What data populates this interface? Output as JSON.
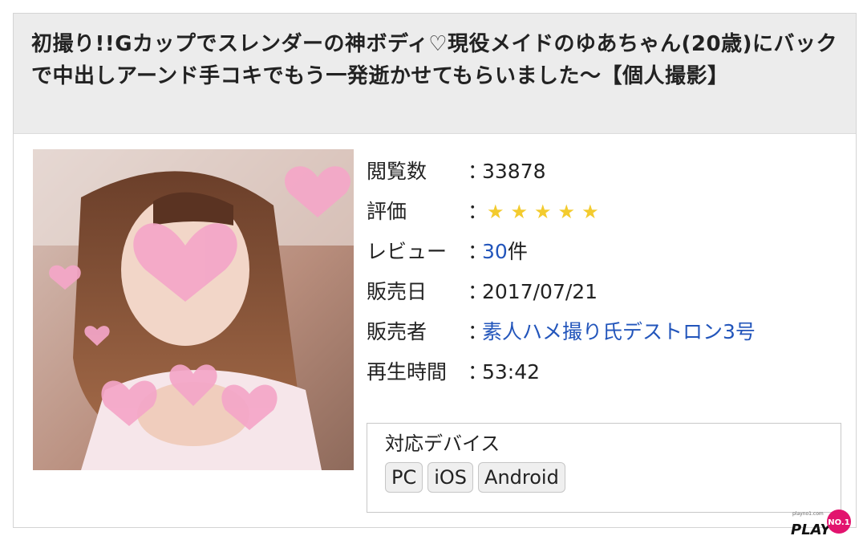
{
  "title": "初撮り!!Gカップでスレンダーの神ボディ♡現役メイドのゆあちゃん(20歳)にバックで中出しアーンド手コキでもう一発逝かせてもらいました〜【個人撮影】",
  "details": {
    "views_label": "閲覧数",
    "views_value": "33878",
    "rating_label": "評価",
    "rating_value": 5,
    "rating_star": "★",
    "review_label": "レビュー",
    "review_count": "30",
    "review_unit": "件",
    "date_label": "販売日",
    "date_value": "2017/07/21",
    "seller_label": "販売者",
    "seller_value": "素人ハメ撮り氏デストロン3号",
    "duration_label": "再生時間",
    "duration_value": "53:42",
    "colon": "："
  },
  "devices": {
    "title": "対応デバイス",
    "items": [
      "PC",
      "iOS",
      "Android"
    ]
  },
  "watermark": {
    "small_text": "playno1.com",
    "brand": "PLAY",
    "badge": "NO.1"
  },
  "colors": {
    "link": "#2255bb",
    "star": "#f3cb2e",
    "title_bg": "#ececec",
    "badge": "#e2136e"
  }
}
